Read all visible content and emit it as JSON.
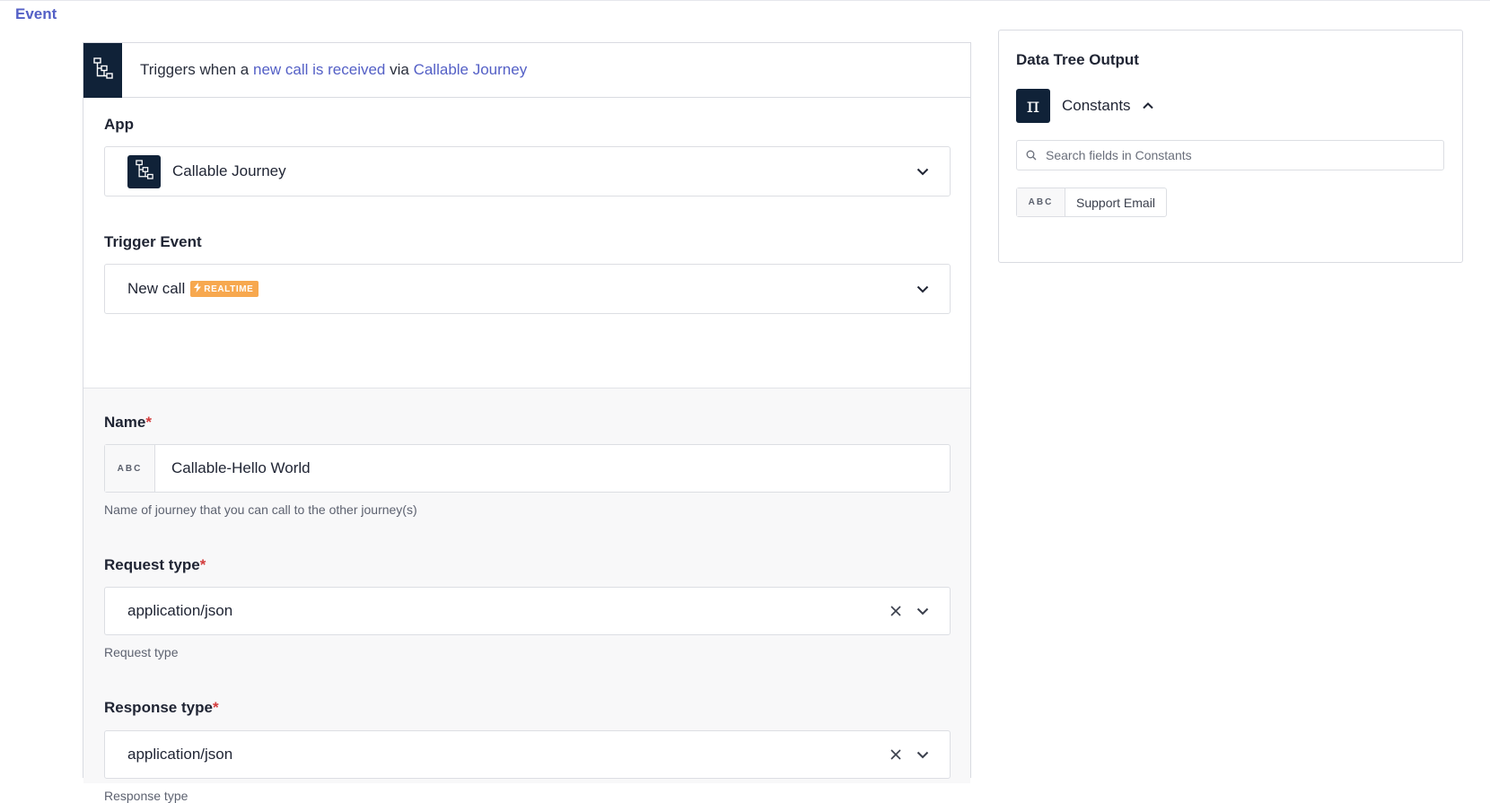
{
  "header": {
    "tab_label": "Event"
  },
  "trigger": {
    "prefix": "Triggers when a ",
    "event_link": "new call is received",
    "middle": " via ",
    "app_link": "Callable Journey",
    "icon": "flow-chart-icon"
  },
  "app_field": {
    "label": "App",
    "value": "Callable Journey",
    "icon": "flow-chart-icon"
  },
  "trigger_event_field": {
    "label": "Trigger Event",
    "value": "New call",
    "badge": "REALTIME",
    "badge_color": "#f7a84f"
  },
  "name_field": {
    "label": "Name",
    "required_mark": "*",
    "type_tag": "ABC",
    "value": "Callable-Hello World",
    "hint": "Name of journey that you can call to the other journey(s)"
  },
  "request_type_field": {
    "label": "Request type",
    "required_mark": "*",
    "value": "application/json",
    "hint": "Request type"
  },
  "response_type_field": {
    "label": "Response type",
    "required_mark": "*",
    "value": "application/json",
    "hint": "Response type"
  },
  "data_tree": {
    "title": "Data Tree Output",
    "group_label": "Constants",
    "group_icon": "pi-icon",
    "search_placeholder": "Search fields in Constants",
    "items": [
      {
        "type": "ABC",
        "label": "Support Email"
      }
    ]
  },
  "colors": {
    "accent": "#5460c6",
    "dark_icon_bg": "#102238",
    "required": "#d33b3b"
  }
}
